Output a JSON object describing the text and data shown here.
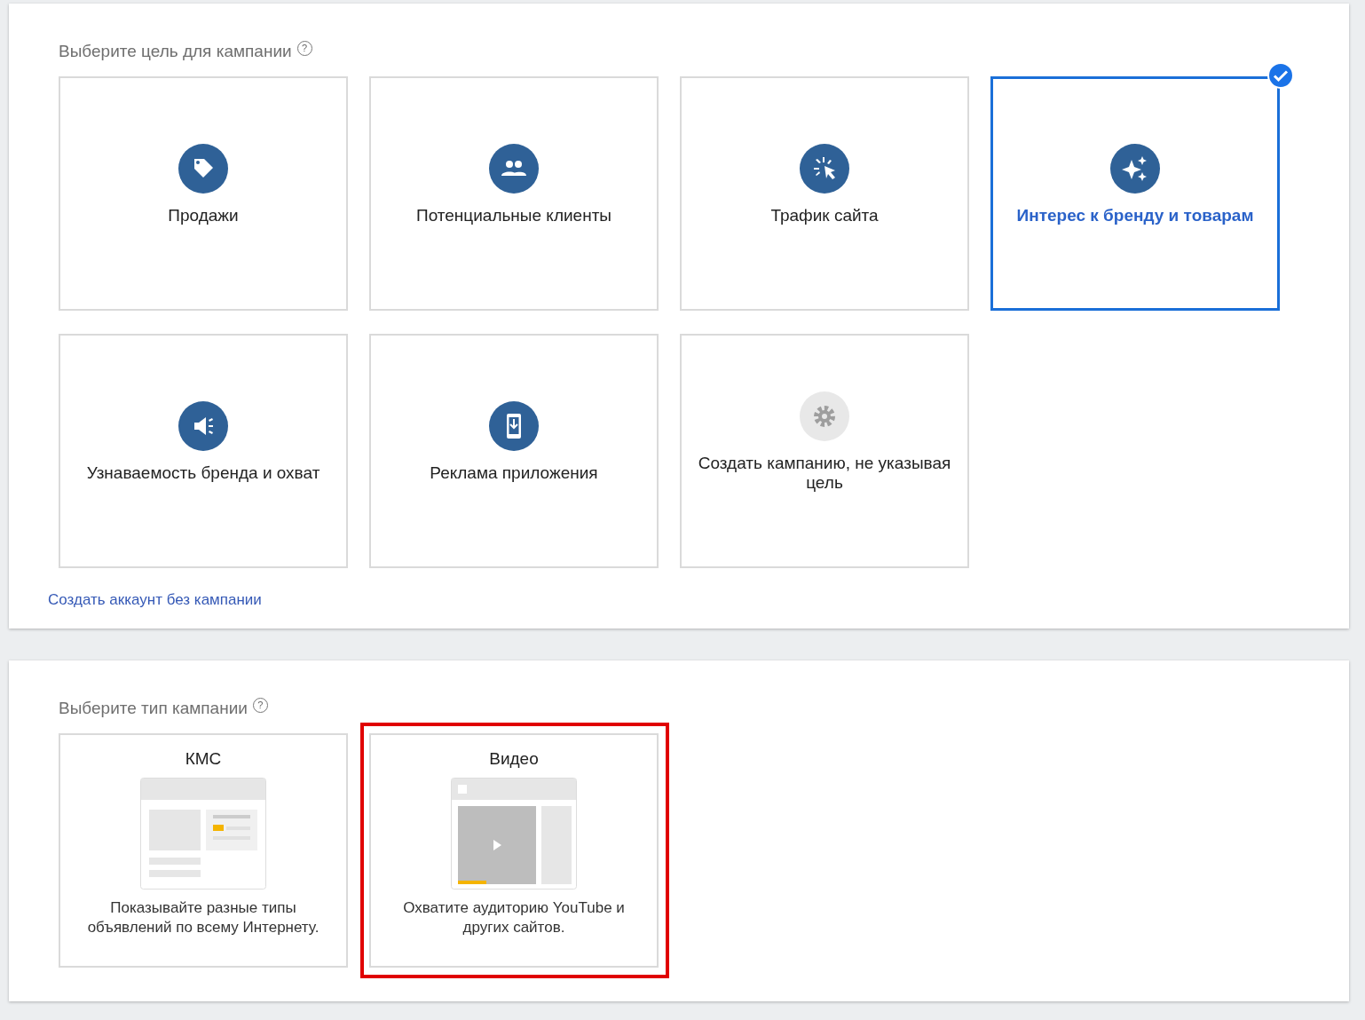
{
  "goal_section": {
    "title": "Выберите цель для кампании",
    "help": "?",
    "goals": [
      {
        "label": "Продажи",
        "kind": "tag",
        "selected": false
      },
      {
        "label": "Потенциальные клиенты",
        "kind": "people",
        "selected": false
      },
      {
        "label": "Трафик сайта",
        "kind": "cursor",
        "selected": false
      },
      {
        "label": "Интерес к бренду и товарам",
        "kind": "sparkle",
        "selected": true
      },
      {
        "label": "Узнаваемость бренда и охват",
        "kind": "megaphone",
        "selected": false
      },
      {
        "label": "Реклама приложения",
        "kind": "phone",
        "selected": false
      },
      {
        "label": "Создать кампанию, не указывая цель",
        "kind": "gear",
        "selected": false
      }
    ],
    "link": "Создать аккаунт без кампании"
  },
  "type_section": {
    "title": "Выберите тип кампании",
    "help": "?",
    "types": [
      {
        "kind": "display",
        "title": "КМС",
        "description": "Показывайте разные типы объявлений по всему Интернету.",
        "highlighted": false
      },
      {
        "kind": "video",
        "title": "Видео",
        "description": "Охватите аудиторию YouTube и других сайтов.",
        "highlighted": true
      }
    ]
  }
}
